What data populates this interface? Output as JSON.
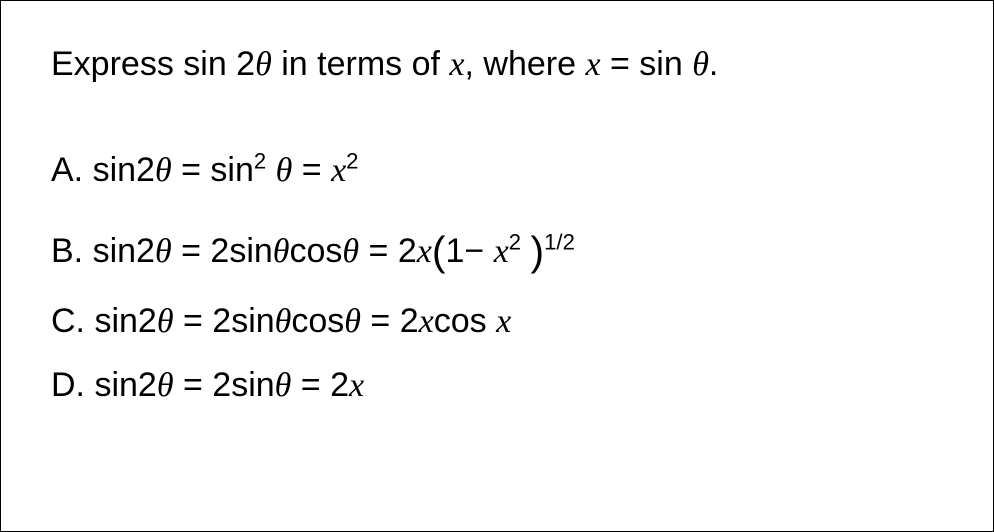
{
  "question": {
    "prefix": "Express sin 2",
    "theta1": "θ",
    "mid": " in terms of ",
    "x1": "x",
    "comma": ", where ",
    "x2": "x",
    "eq": " = sin ",
    "theta2": "θ",
    "period": "."
  },
  "options": {
    "A": {
      "label": "A.",
      "p1": " sin2",
      "theta1": "θ",
      "eq1": " = sin",
      "sup1": "2",
      "sp1": " ",
      "theta2": "θ",
      "eq2": " = ",
      "x1": "x",
      "sup2": "2"
    },
    "B": {
      "label": "B.",
      "p1": " sin2",
      "theta1": "θ",
      "eq1": " = 2sin",
      "theta2": "θ",
      "cos": "cos",
      "theta3": "θ",
      "eq2": " = 2",
      "x1": "x",
      "lparen": "(",
      "one": "1",
      "minus": "− ",
      "x2": "x",
      "sup1": "2",
      "sp": " ",
      "rparen": ")",
      "sup2": "1/2"
    },
    "C": {
      "label": "C.",
      "p1": " sin2",
      "theta1": "θ",
      "eq1": " = 2sin",
      "theta2": "θ",
      "cos": "cos",
      "theta3": "θ",
      "eq2": " = 2",
      "x1": "x",
      "cos2": "cos ",
      "x2": "x"
    },
    "D": {
      "label": "D.",
      "p1": " sin2",
      "theta1": "θ",
      "eq1": " = 2sin",
      "theta2": "θ",
      "eq2": " = 2",
      "x1": "x"
    }
  }
}
